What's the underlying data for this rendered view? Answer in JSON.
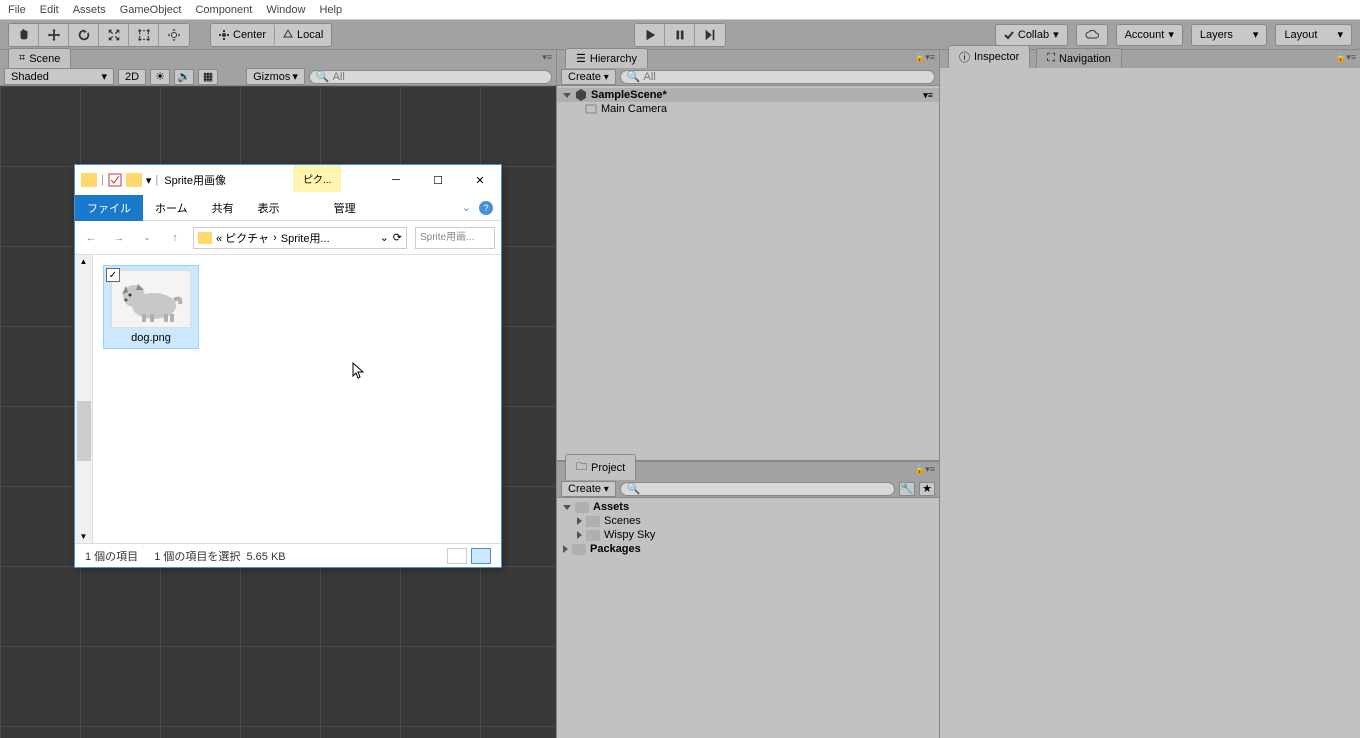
{
  "menu": {
    "file": "File",
    "edit": "Edit",
    "assets": "Assets",
    "gameobject": "GameObject",
    "component": "Component",
    "window": "Window",
    "help": "Help"
  },
  "toolbar": {
    "center": "Center",
    "local": "Local",
    "collab": "Collab",
    "account": "Account",
    "layers": "Layers",
    "layout": "Layout"
  },
  "scene": {
    "tab": "Scene",
    "shaded": "Shaded",
    "twod": "2D",
    "gizmos": "Gizmos",
    "search_placeholder": "All"
  },
  "hierarchy": {
    "tab": "Hierarchy",
    "create": "Create",
    "search_placeholder": "All",
    "scene_name": "SampleScene*",
    "items": [
      "Main Camera"
    ]
  },
  "project": {
    "tab": "Project",
    "create": "Create",
    "assets": "Assets",
    "folders": [
      "Scenes",
      "Wispy Sky"
    ],
    "packages": "Packages"
  },
  "inspector": {
    "tab": "Inspector",
    "nav_tab": "Navigation"
  },
  "explorer": {
    "title": "Sprite用画像",
    "yellow_tab": "ピク...",
    "ribbon": {
      "file": "ファイル",
      "home": "ホーム",
      "share": "共有",
      "view": "表示",
      "manage": "管理"
    },
    "breadcrumb": {
      "p1": "« ピクチャ",
      "p2": "Sprite用..."
    },
    "search_placeholder": "Sprite用画...",
    "file": {
      "name": "dog.png"
    },
    "status": {
      "count": "1 個の項目",
      "selected": "1 個の項目を選択",
      "size": "5.65 KB"
    }
  }
}
